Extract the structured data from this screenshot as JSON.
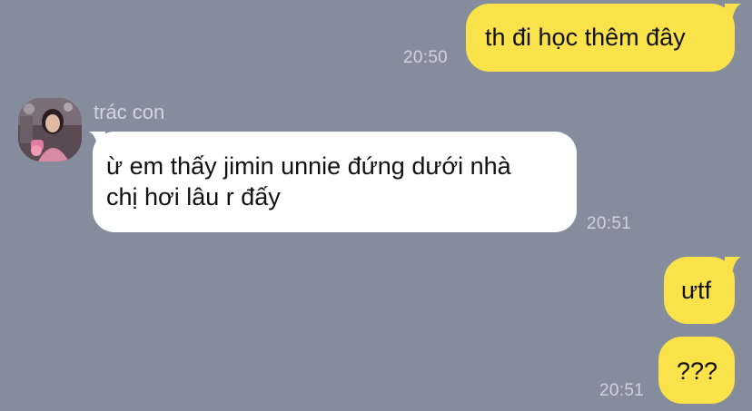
{
  "messages": [
    {
      "text": "th đi học thêm đây",
      "time": "20:50"
    },
    {
      "sender": "trác con",
      "avatar": "contact-avatar-photo",
      "line1": "ừ em thấy jimin unnie đứng dưới nhà",
      "line2": "chị hơi lâu r đấy",
      "time": "20:51"
    },
    {
      "text": "ưtf"
    },
    {
      "text": "???",
      "time": "20:51"
    }
  ],
  "colors": {
    "background": "#858c9c",
    "outgoing_bubble": "#fae24a",
    "incoming_bubble": "#ffffff",
    "timestamp": "#cfd3dc"
  }
}
